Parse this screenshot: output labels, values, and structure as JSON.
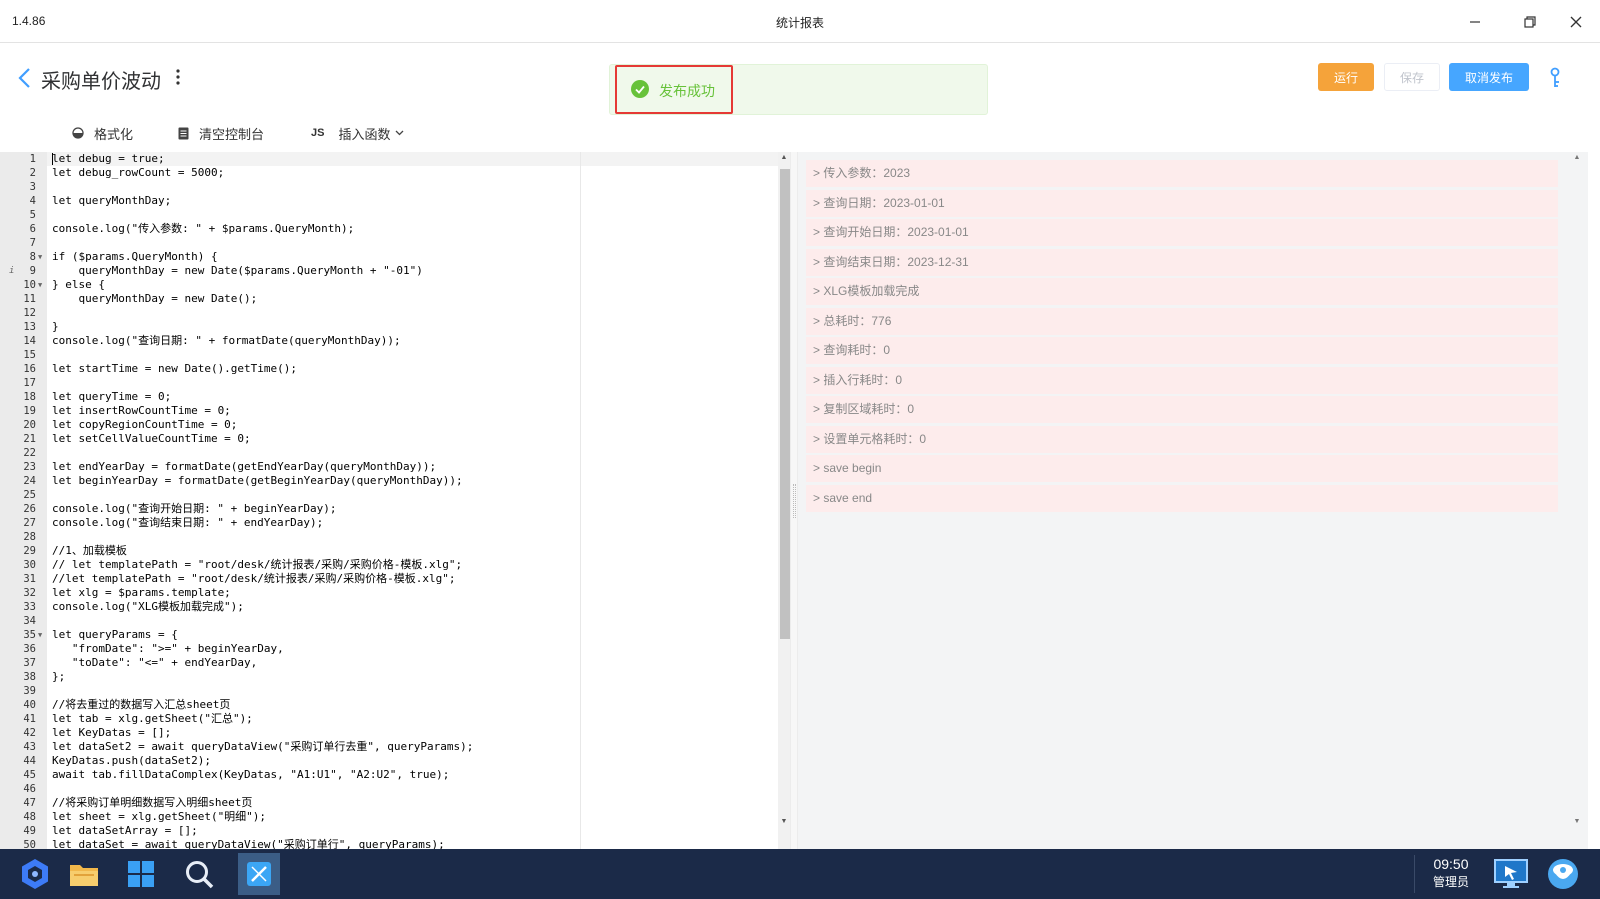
{
  "window": {
    "version": "1.4.86",
    "title": "统计报表"
  },
  "header": {
    "title": "采购单价波动"
  },
  "toast": {
    "message": "发布成功"
  },
  "buttons": {
    "run": "运行",
    "save": "保存",
    "unpublish": "取消发布"
  },
  "toolbar": {
    "format": "格式化",
    "clear_console": "清空控制台",
    "insert_function": "插入函数",
    "js_mark": "JS"
  },
  "code": {
    "lines": [
      "1",
      "2",
      "3",
      "4",
      "5",
      "6",
      "7",
      "8",
      "9",
      "10",
      "11",
      "12",
      "13",
      "14",
      "15",
      "16",
      "17",
      "18",
      "19",
      "20",
      "21",
      "22",
      "23",
      "24",
      "25",
      "26",
      "27",
      "28",
      "29",
      "30",
      "31",
      "32",
      "33",
      "34",
      "35",
      "36",
      "37",
      "38",
      "39",
      "40",
      "41",
      "42",
      "43",
      "44",
      "45",
      "46",
      "47",
      "48",
      "49",
      "50"
    ],
    "text": [
      "let debug = true;",
      "let debug_rowCount = 5000;",
      "",
      "let queryMonthDay;",
      "",
      "console.log(\"传入参数: \" + $params.QueryMonth);",
      "",
      "if ($params.QueryMonth) {",
      "    queryMonthDay = new Date($params.QueryMonth + \"-01\")",
      "} else {",
      "    queryMonthDay = new Date();",
      "",
      "}",
      "console.log(\"查询日期: \" + formatDate(queryMonthDay));",
      "",
      "let startTime = new Date().getTime();",
      "",
      "let queryTime = 0;",
      "let insertRowCountTime = 0;",
      "let copyRegionCountTime = 0;",
      "let setCellValueCountTime = 0;",
      "",
      "let endYearDay = formatDate(getEndYearDay(queryMonthDay));",
      "let beginYearDay = formatDate(getBeginYearDay(queryMonthDay));",
      "",
      "console.log(\"查询开始日期: \" + beginYearDay);",
      "console.log(\"查询结束日期: \" + endYearDay);",
      "",
      "//1、加载模板",
      "// let templatePath = \"root/desk/统计报表/采购/采购价格-模板.xlg\";",
      "//let templatePath = \"root/desk/统计报表/采购/采购价格-模板.xlg\";",
      "let xlg = $params.template;",
      "console.log(\"XLG模板加载完成\");",
      "",
      "let queryParams = {",
      "   \"fromDate\": \">=\" + beginYearDay,",
      "   \"toDate\": \"<=\" + endYearDay,",
      "};",
      "",
      "//将去重过的数据写入汇总sheet页",
      "let tab = xlg.getSheet(\"汇总\");",
      "let KeyDatas = [];",
      "let dataSet2 = await queryDataView(\"采购订单行去重\", queryParams);",
      "KeyDatas.push(dataSet2);",
      "await tab.fillDataComplex(KeyDatas, \"A1:U1\", \"A2:U2\", true);",
      "",
      "//将采购订单明细数据写入明细sheet页",
      "let sheet = xlg.getSheet(\"明细\");",
      "let dataSetArray = [];",
      "let dataSet = await queryDataView(\"采购订单行\", queryParams);"
    ]
  },
  "console": {
    "lines": [
      "> 传入参数：2023",
      "> 查询日期：2023-01-01",
      "> 查询开始日期：2023-01-01",
      "> 查询结束日期：2023-12-31",
      "> XLG模板加载完成",
      "> 总耗时：776",
      "> 查询耗时：0",
      "> 插入行耗时：0",
      "> 复制区域耗时：0",
      "> 设置单元格耗时：0",
      "> save begin",
      "> save end"
    ]
  },
  "taskbar": {
    "time": "09:50",
    "user": "管理员"
  },
  "colors": {
    "run": "#f5a33a",
    "unpublish": "#46a6ff",
    "success": "#67c23a",
    "taskbar": "#1b2a48"
  }
}
